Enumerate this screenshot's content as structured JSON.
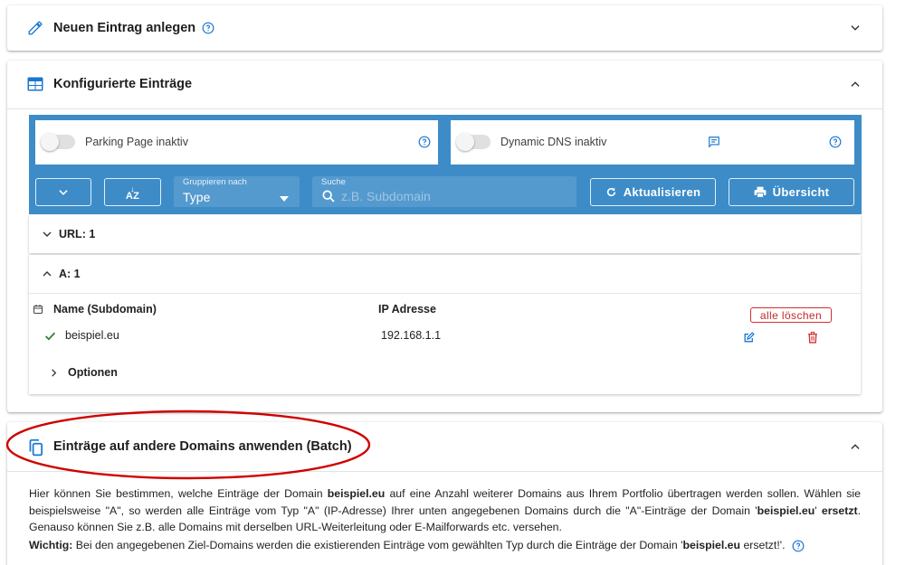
{
  "cards": {
    "new_entry": {
      "title": "Neuen Eintrag anlegen"
    },
    "configured": {
      "title": "Konfigurierte Einträge"
    },
    "batch": {
      "title": "Einträge auf andere Domains anwenden (Batch)"
    }
  },
  "toolbar": {
    "parking_label": "Parking Page inaktiv",
    "ddns_label": "Dynamic DNS inaktiv",
    "group_by_label": "Gruppieren nach",
    "group_by_value": "Type",
    "search_label": "Suche",
    "search_placeholder": "z.B. Subdomain",
    "refresh_label": "Aktualisieren",
    "overview_label": "Übersicht",
    "sort_icon_text": "AZ"
  },
  "groups": {
    "url": {
      "label": "URL: 1"
    },
    "a": {
      "label": "A: 1",
      "col_name": "Name (Subdomain)",
      "col_ip": "IP Adresse",
      "delete_all": "alle löschen",
      "rows": [
        {
          "name": "beispiel.eu",
          "ip": "192.168.1.1"
        }
      ],
      "options_label": "Optionen"
    }
  },
  "batch": {
    "desc_1": "Hier können Sie bestimmen, welche Einträge der Domain ",
    "desc_domain_1": "beispiel.eu",
    "desc_2": " auf eine Anzahl weiterer Domains aus Ihrem Portfolio übertragen werden sollen. Wählen sie beispielsweise \"A\", so werden alle Einträge vom Typ \"A\" (IP-Adresse) Ihrer unten angegebenen Domains durch die \"A\"-Einträge der Domain '",
    "desc_domain_2": "beispiel.eu",
    "desc_3": "' ",
    "desc_replaced": "ersetzt",
    "desc_4": ". Genauso können Sie z.B. alle Domains mit derselben URL-Weiterleitung oder E-Mailforwards etc. versehen.",
    "warn_label": "Wichtig:",
    "warn_1": " Bei den angegebenen Ziel-Domains werden die existierenden Einträge vom gewählten Typ durch die Einträge der Domain '",
    "warn_domain": "beispiel.eu",
    "warn_2": " ersetzt!'."
  },
  "colors": {
    "accent": "#3d8cc8",
    "icon_blue": "#1976d2",
    "danger": "#d32f2f",
    "success": "#2e7d32",
    "annotation_red": "#d00000"
  },
  "icons": [
    "pencil-icon",
    "help-icon",
    "chevron-down-icon",
    "table-icon",
    "chevron-up-icon",
    "comment-icon",
    "sort-alpha-icon",
    "refresh-icon",
    "printer-icon",
    "search-icon",
    "calendar-icon",
    "check-icon",
    "edit-icon",
    "trash-icon",
    "chevron-right-icon",
    "copy-icon"
  ]
}
